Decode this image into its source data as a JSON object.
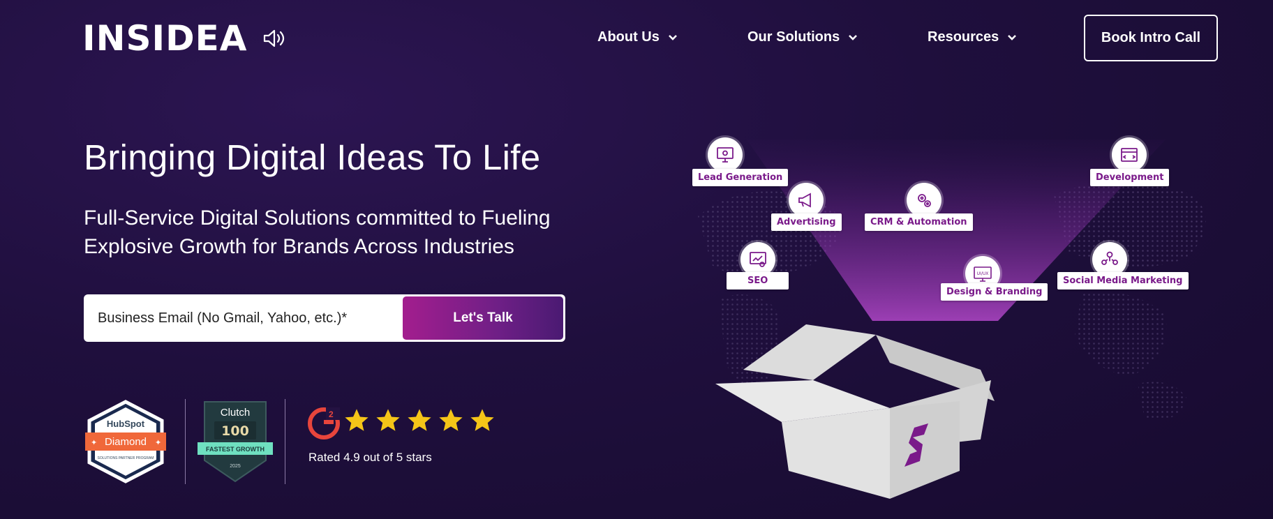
{
  "brand": {
    "logo": "INSIDEA"
  },
  "nav": {
    "items": [
      {
        "label": "About Us"
      },
      {
        "label": "Our Solutions"
      },
      {
        "label": "Resources"
      }
    ],
    "cta": "Book Intro Call"
  },
  "hero": {
    "headline": "Bringing Digital Ideas To Life",
    "subline": "Full-Service Digital Solutions committed to Fueling Explosive Growth for Brands Across Industries"
  },
  "form": {
    "email_placeholder": "Business Email (No Gmail, Yahoo, etc.)*",
    "submit_label": "Let's Talk"
  },
  "badges": {
    "hubspot": {
      "brand": "HubSpot",
      "tier": "Diamond",
      "program": "SOLUTIONS PARTNER PROGRAM"
    },
    "clutch": {
      "brand": "Clutch",
      "rank": "100",
      "ribbon": "FASTEST GROWTH",
      "year": "2025"
    },
    "g2": {
      "logo": "G2",
      "stars": 5,
      "rating_text": "Rated 4.9 out of 5 stars"
    }
  },
  "services": [
    {
      "label": "Lead Generation",
      "icon": "monitor-gear-icon"
    },
    {
      "label": "Development",
      "icon": "browser-code-icon"
    },
    {
      "label": "Advertising",
      "icon": "megaphone-icon"
    },
    {
      "label": "CRM & Automation",
      "icon": "gears-icon"
    },
    {
      "label": "SEO",
      "icon": "seo-chart-icon"
    },
    {
      "label": "Design & Branding",
      "icon": "ui-ux-icon",
      "icon_text": "UI/UX"
    },
    {
      "label": "Social Media Marketing",
      "icon": "social-network-icon"
    }
  ],
  "colors": {
    "background": "#1f0f3d",
    "accent_magenta": "#a31e8e",
    "accent_purple": "#6e1f86",
    "chip_text": "#7a1a8a",
    "hubspot_orange": "#f0683a",
    "clutch_teal": "#3dd6a8",
    "g2_red": "#e8453c",
    "star_gold": "#f5c518"
  }
}
